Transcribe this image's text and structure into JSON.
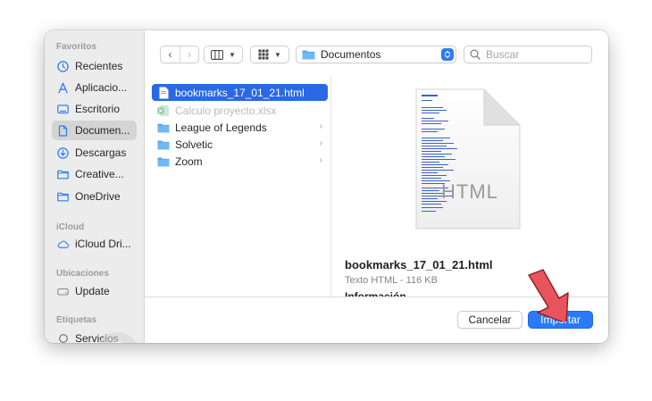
{
  "sidebar": {
    "sections": [
      {
        "title": "Favoritos"
      },
      {
        "title": "iCloud"
      },
      {
        "title": "Ubicaciones"
      },
      {
        "title": "Etiquetas"
      }
    ],
    "favorites": [
      {
        "label": "Recientes",
        "icon": "clock-icon"
      },
      {
        "label": "Aplicacio...",
        "icon": "applications-icon"
      },
      {
        "label": "Escritorio",
        "icon": "desktop-icon"
      },
      {
        "label": "Documen...",
        "icon": "document-icon"
      },
      {
        "label": "Descargas",
        "icon": "download-icon"
      },
      {
        "label": "Creative...",
        "icon": "folder-icon"
      },
      {
        "label": "OneDrive",
        "icon": "folder-icon"
      }
    ],
    "icloud": [
      {
        "label": "iCloud Dri...",
        "icon": "cloud-icon"
      }
    ],
    "locations": [
      {
        "label": "Update",
        "icon": "drive-icon"
      }
    ],
    "tags": [
      {
        "label": "Servicios",
        "icon": "tag-circle-icon"
      }
    ]
  },
  "toolbar": {
    "back_glyph": "‹",
    "forward_glyph": "›",
    "location": "Documentos",
    "search_placeholder": "Buscar"
  },
  "files": [
    {
      "name": "bookmarks_17_01_21.html",
      "selected": true,
      "dimmed": false,
      "folder": false
    },
    {
      "name": "Calculo proyecto.xlsx",
      "selected": false,
      "dimmed": true,
      "folder": false
    },
    {
      "name": "League of Legends",
      "selected": false,
      "dimmed": false,
      "folder": true
    },
    {
      "name": "Solvetic",
      "selected": false,
      "dimmed": false,
      "folder": true
    },
    {
      "name": "Zoom",
      "selected": false,
      "dimmed": false,
      "folder": true
    }
  ],
  "preview": {
    "doc_badge": "HTML",
    "filename": "bookmarks_17_01_21.html",
    "meta": "Texto HTML - 116 KB",
    "info_label": "Información"
  },
  "buttons": {
    "cancel": "Cancelar",
    "import": "Importar"
  },
  "colors": {
    "accent": "#2a7af6",
    "selection": "#2969e6",
    "folder": "#5aa9f0",
    "arrow": "#e8545c"
  }
}
